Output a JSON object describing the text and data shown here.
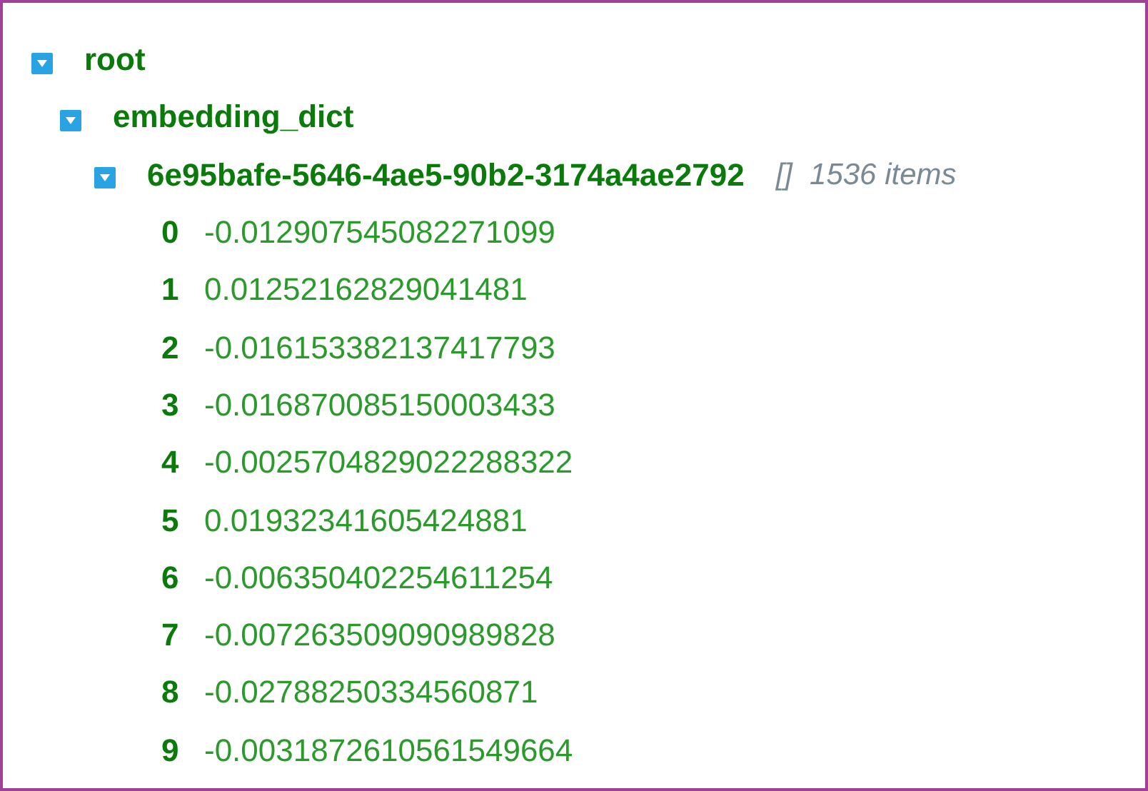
{
  "tree": {
    "key": "root",
    "expanded": true,
    "children": [
      {
        "key": "embedding_dict",
        "expanded": true,
        "children": [
          {
            "key": "6e95bafe-5646-4ae5-90b2-3174a4ae2792",
            "expanded": true,
            "type_marker": "[]",
            "count": "1536 items",
            "children": [
              {
                "key": "0",
                "value": "-0.012907545082271099"
              },
              {
                "key": "1",
                "value": "0.01252162829041481"
              },
              {
                "key": "2",
                "value": "-0.016153382137417793"
              },
              {
                "key": "3",
                "value": "-0.016870085150003433"
              },
              {
                "key": "4",
                "value": "-0.0025704829022288322"
              },
              {
                "key": "5",
                "value": "0.01932341605424881"
              },
              {
                "key": "6",
                "value": "-0.006350402254611254"
              },
              {
                "key": "7",
                "value": "-0.007263509090989828"
              },
              {
                "key": "8",
                "value": "-0.02788250334560871"
              },
              {
                "key": "9",
                "value": "-0.0031872610561549664"
              }
            ]
          }
        ]
      }
    ]
  }
}
